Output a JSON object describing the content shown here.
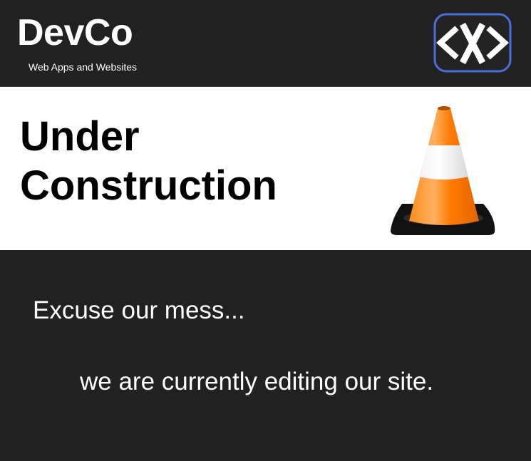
{
  "header": {
    "brand_name": "DevCo",
    "tagline": "Web Apps and Websites",
    "logo_icon": "code-brackets-x-icon"
  },
  "hero": {
    "title_line_1": "Under",
    "title_line_2": "Construction",
    "image_icon": "traffic-cone-icon"
  },
  "message": {
    "line_1": "Excuse our mess...",
    "line_2": "we are currently editing our site."
  },
  "colors": {
    "background_dark": "#212121",
    "hero_background": "#ffffff",
    "logo_border": "#4a6fd8",
    "cone_orange": "#ff7a00",
    "cone_stripe": "#eeeeee"
  }
}
